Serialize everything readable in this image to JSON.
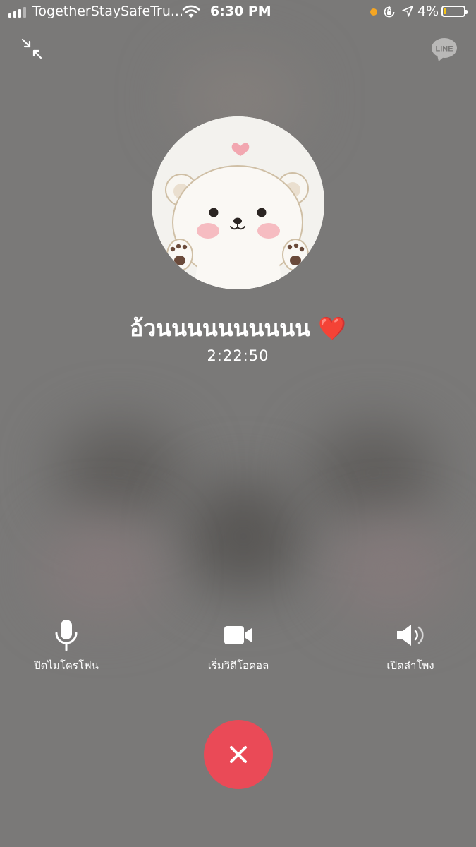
{
  "status_bar": {
    "carrier": "TogetherStaySafeTru...",
    "time": "6:30 PM",
    "battery_percent": "4%",
    "battery_level": 0.04,
    "icons": [
      "signal-icon",
      "wifi-icon",
      "orange-dot-indicator",
      "orientation-lock-icon",
      "location-arrow-icon",
      "battery-icon"
    ]
  },
  "top_bar": {
    "minimize_icon": "collapse-arrows-icon",
    "logo_text": "LINE"
  },
  "call": {
    "contact_name": "อ้วนนนนนนนนนน",
    "emoji": "❤️",
    "duration": "2:22:50"
  },
  "controls": {
    "mute_label": "ปิดไมโครโฟน",
    "video_label": "เริ่มวิดีโอคอล",
    "speaker_label": "เปิดลำโพง",
    "end_call_icon": "close-icon"
  },
  "colors": {
    "end_call": "#ea4a57",
    "wave_start": "#4fb7d7",
    "wave_end": "#3ec66e",
    "background": "#7a7978"
  }
}
